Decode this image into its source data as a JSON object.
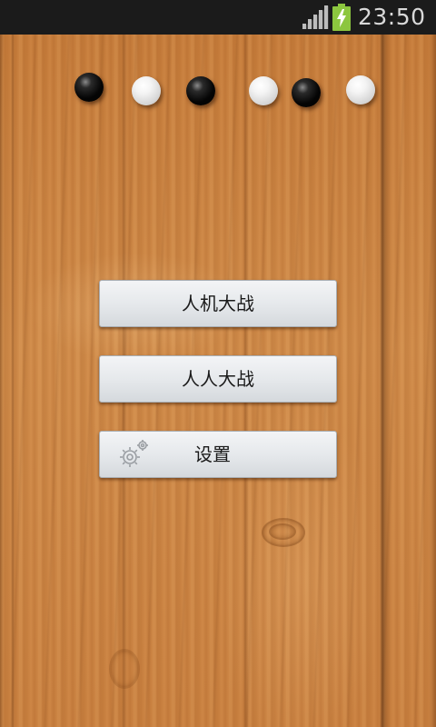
{
  "status_bar": {
    "time": "23:50",
    "signal_icon": "signal-bars-icon",
    "battery_icon": "battery-charging-icon",
    "battery_color": "#8cc63f"
  },
  "background": {
    "texture": "wood",
    "wood_color": "#c87f3e"
  },
  "decor_stones": [
    {
      "color": "black"
    },
    {
      "color": "white"
    },
    {
      "color": "black"
    },
    {
      "color": "white"
    },
    {
      "color": "black"
    },
    {
      "color": "white"
    }
  ],
  "menu": {
    "vs_computer_label": "人机大战",
    "vs_human_label": "人人大战",
    "settings_label": "设置",
    "settings_icon": "gear-icon"
  }
}
